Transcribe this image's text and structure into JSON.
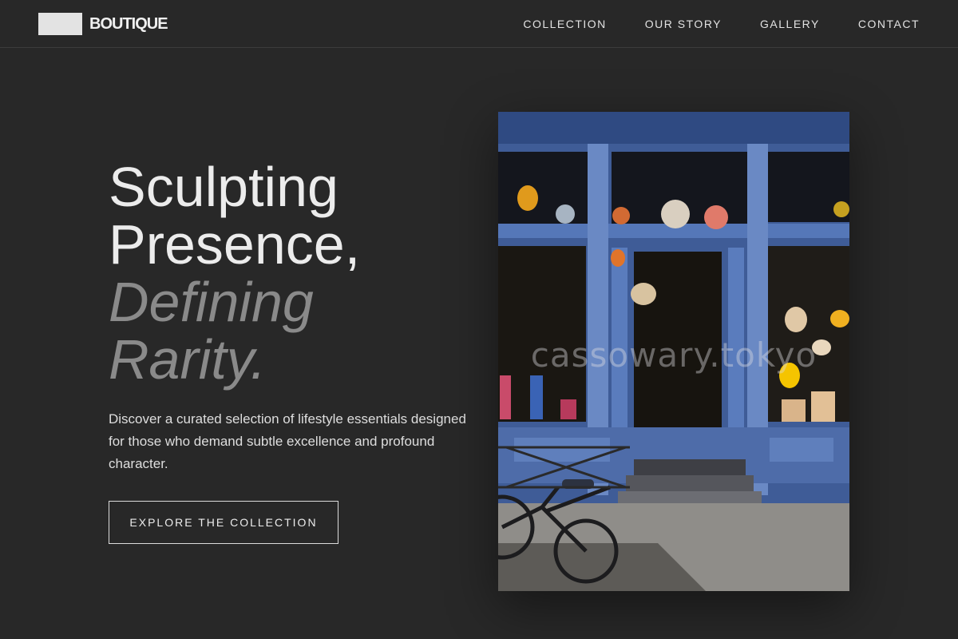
{
  "header": {
    "brand": "BOUTIQUE",
    "nav": [
      "COLLECTION",
      "OUR STORY",
      "GALLERY",
      "CONTACT"
    ]
  },
  "hero": {
    "title_plain": [
      "Sculpting",
      "Presence,"
    ],
    "title_accent": [
      "Defining",
      "Rarity."
    ],
    "description": "Discover a curated selection of lifestyle essentials designed for those who demand subtle excellence and profound character.",
    "cta_label": "EXPLORE THE COLLECTION",
    "image_watermark": "cassowary.tokyo"
  },
  "colors": {
    "background": "#282828",
    "text": "#ececec",
    "accent_text": "#8a8a8a",
    "storefront_blue": "#4a68a6"
  }
}
